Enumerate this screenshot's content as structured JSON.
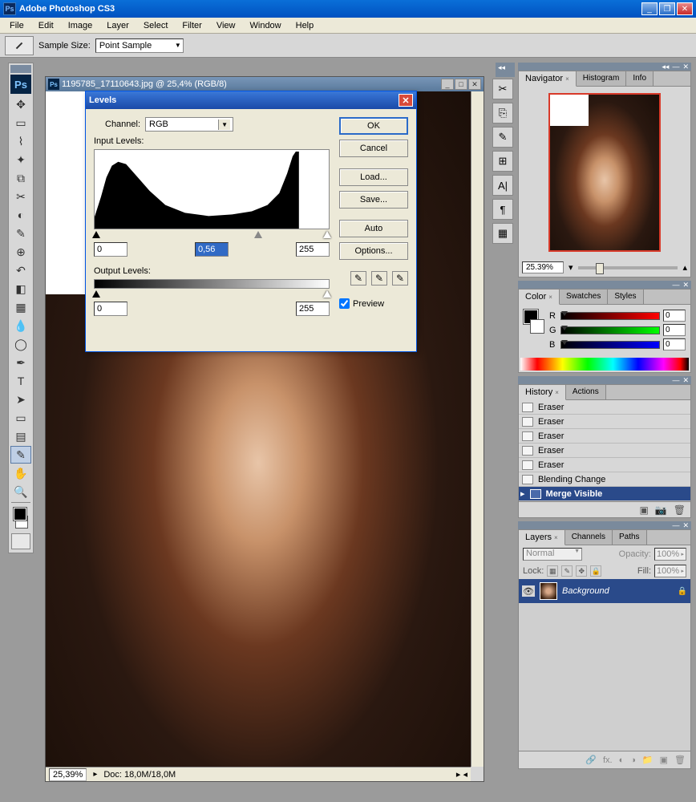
{
  "app": {
    "title": "Adobe Photoshop CS3"
  },
  "menu": [
    "File",
    "Edit",
    "Image",
    "Layer",
    "Select",
    "Filter",
    "View",
    "Window",
    "Help"
  ],
  "options": {
    "sample_label": "Sample Size:",
    "sample_value": "Point Sample"
  },
  "document": {
    "title": "1195785_17110643.jpg @ 25,4% (RGB/8)",
    "zoom": "25,39%",
    "doc_info": "Doc: 18,0M/18,0M"
  },
  "levels": {
    "title": "Levels",
    "channel_label": "Channel:",
    "channel_value": "RGB",
    "input_label": "Input Levels:",
    "output_label": "Output Levels:",
    "in_black": "0",
    "in_mid": "0,56",
    "in_white": "255",
    "out_black": "0",
    "out_white": "255",
    "btn_ok": "OK",
    "btn_cancel": "Cancel",
    "btn_load": "Load...",
    "btn_save": "Save...",
    "btn_auto": "Auto",
    "btn_options": "Options...",
    "preview": "Preview"
  },
  "navigator": {
    "tabs": [
      "Navigator",
      "Histogram",
      "Info"
    ],
    "zoom": "25.39%"
  },
  "color": {
    "tabs": [
      "Color",
      "Swatches",
      "Styles"
    ],
    "r_label": "R",
    "g_label": "G",
    "b_label": "B",
    "r": "0",
    "g": "0",
    "b": "0"
  },
  "history": {
    "tabs": [
      "History",
      "Actions"
    ],
    "items": [
      "Eraser",
      "Eraser",
      "Eraser",
      "Eraser",
      "Eraser",
      "Blending Change",
      "Merge Visible"
    ]
  },
  "layers": {
    "tabs": [
      "Layers",
      "Channels",
      "Paths"
    ],
    "blend": "Normal",
    "opacity_label": "Opacity:",
    "opacity": "100%",
    "lock_label": "Lock:",
    "fill_label": "Fill:",
    "fill": "100%",
    "layer_name": "Background"
  }
}
